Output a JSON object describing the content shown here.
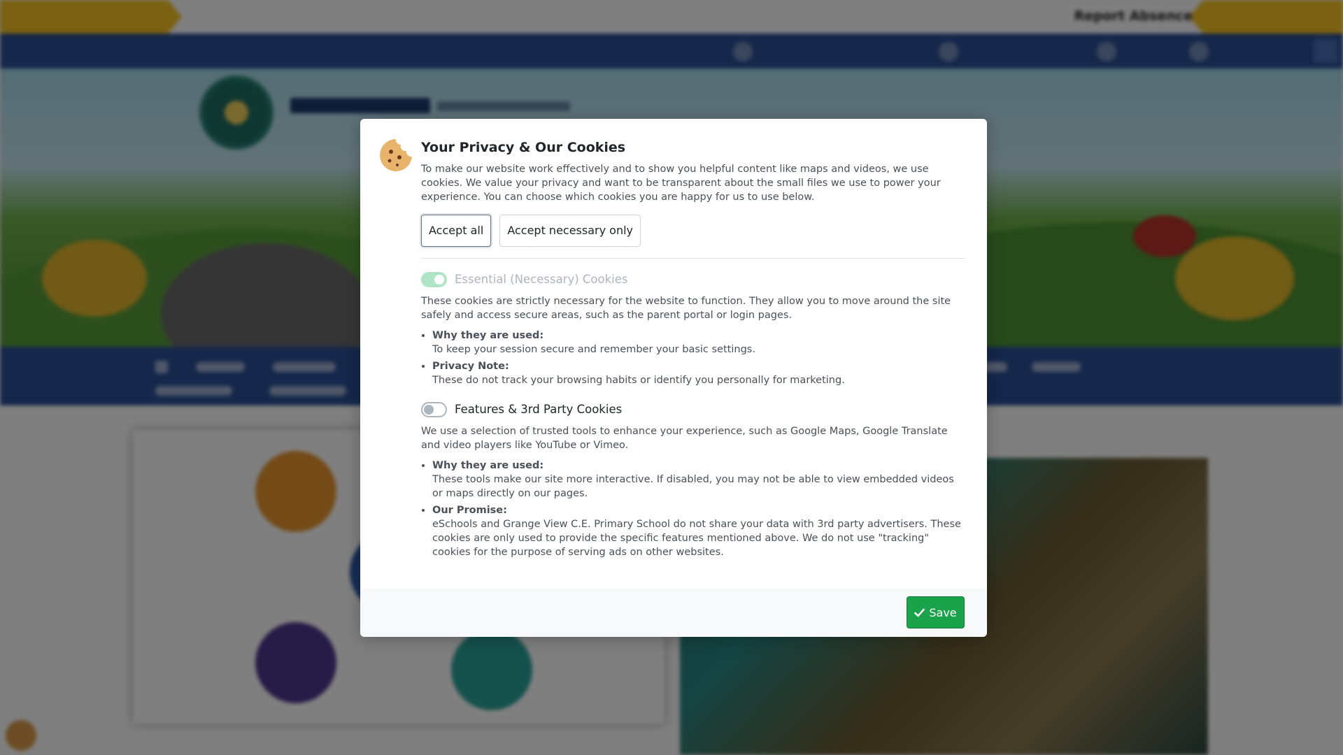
{
  "background": {
    "report_absence": "Report Absence",
    "colors": {
      "yellow": "#f6c324",
      "navy": "#2b4f97",
      "backdrop": "rgba(0,0,0,0.5)"
    }
  },
  "modal": {
    "title": "Your Privacy & Our Cookies",
    "intro": "To make our website work effectively and to show you helpful content like maps and videos, we use cookies. We value your privacy and want to be transparent about the small files we use to power your experience. You can choose which cookies you are happy for us to use below.",
    "buttons": {
      "accept_all": "Accept all",
      "accept_necessary": "Accept necessary only",
      "save": "Save"
    },
    "sections": [
      {
        "label": "Essential (Necessary) Cookies",
        "toggle_on": true,
        "disabled": true,
        "description": "These cookies are strictly necessary for the website to function. They allow you to move around the site safely and access secure areas, such as the parent portal or login pages.",
        "points": [
          {
            "heading": "Why they are used:",
            "text": "To keep your session secure and remember your basic settings."
          },
          {
            "heading": "Privacy Note:",
            "text": "These do not track your browsing habits or identify you personally for marketing."
          }
        ]
      },
      {
        "label": "Features & 3rd Party Cookies",
        "toggle_on": false,
        "disabled": false,
        "description": "We use a selection of trusted tools to enhance your experience, such as Google Maps, Google Translate and video players like YouTube or Vimeo.",
        "points": [
          {
            "heading": "Why they are used:",
            "text": "These tools make our site more interactive. If disabled, you may not be able to view embedded videos or maps directly on our pages."
          },
          {
            "heading": "Our Promise:",
            "text": "eSchools and Grange View C.E. Primary School do not share your data with 3rd party advertisers. These cookies are only used to provide the specific features mentioned above. We do not use \"tracking\" cookies for the purpose of serving ads on other websites."
          }
        ]
      }
    ],
    "icons": {
      "cookie": "cookie-icon",
      "check": "check-icon"
    },
    "colors": {
      "save": "#1aa34a",
      "toggle_on": "#6fcf97"
    }
  }
}
